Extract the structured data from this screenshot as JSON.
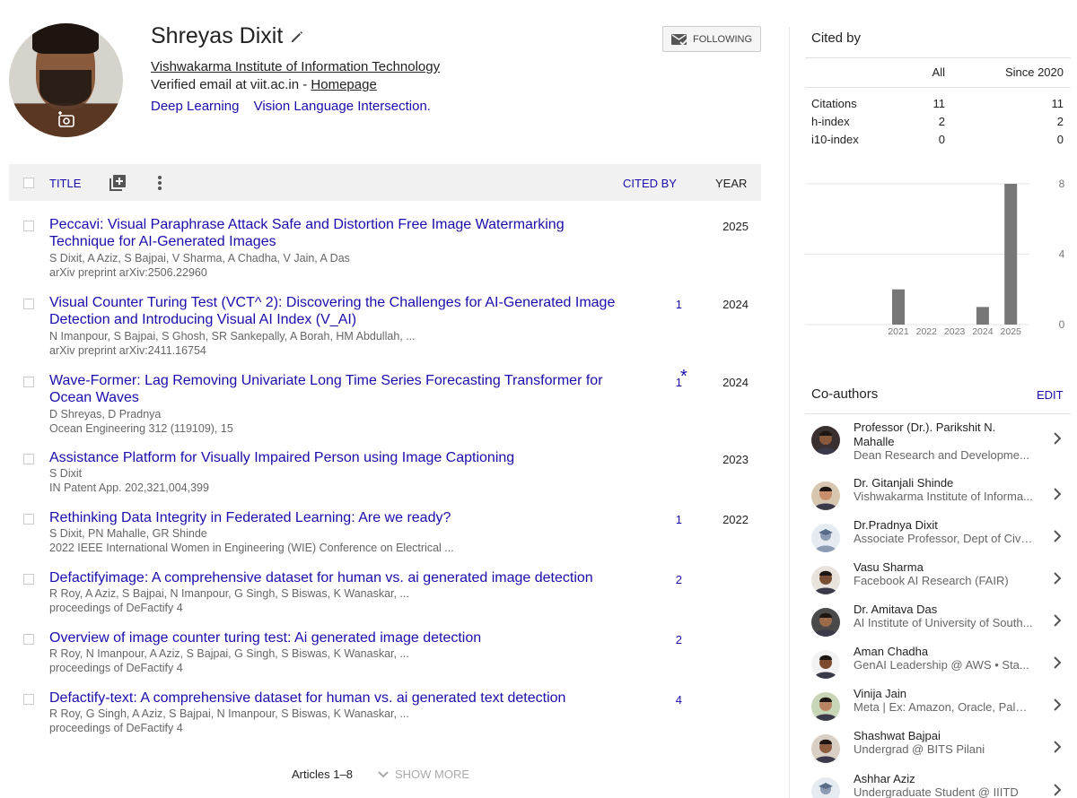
{
  "profile": {
    "name": "Shreyas Dixit",
    "affiliation": "Vishwakarma Institute of Information Technology",
    "email_prefix": "Verified email at viit.ac.in - ",
    "homepage_label": "Homepage",
    "interests": [
      "Deep Learning",
      "Vision Language Intersection."
    ],
    "follow_label": "FOLLOWING"
  },
  "table": {
    "title_header": "TITLE",
    "cited_header": "CITED BY",
    "year_header": "YEAR",
    "articles": [
      {
        "title": "Peccavi: Visual Paraphrase Attack Safe and Distortion Free Image Watermarking Technique for AI-Generated Images",
        "authors": "S Dixit, A Aziz, S Bajpai, V Sharma, A Chadha, V Jain, A Das",
        "venue": "arXiv preprint arXiv:2506.22960",
        "cited": "",
        "year": "2025"
      },
      {
        "title": "Visual Counter Turing Test (VCT^ 2): Discovering the Challenges for AI-Generated Image Detection and Introducing Visual AI Index (V_AI)",
        "authors": "N Imanpour, S Bajpai, S Ghosh, SR Sankepally, A Borah, HM Abdullah, ...",
        "venue": "arXiv preprint arXiv:2411.16754",
        "cited": "1",
        "year": "2024"
      },
      {
        "title": "Wave-Former: Lag Removing Univariate Long Time Series Forecasting Transformer for Ocean Waves",
        "authors": "D Shreyas, D Pradnya",
        "venue": "Ocean Engineering 312 (119109), 15",
        "cited": "1",
        "star": "*",
        "year": "2024"
      },
      {
        "title": "Assistance Platform for Visually Impaired Person using Image Captioning",
        "authors": "S Dixit",
        "venue": "IN Patent App. 202,321,004,399",
        "cited": "",
        "year": "2023"
      },
      {
        "title": "Rethinking Data Integrity in Federated Learning: Are we ready?",
        "authors": "S Dixit, PN Mahalle, GR Shinde",
        "venue": "2022 IEEE International Women in Engineering (WIE) Conference on Electrical ...",
        "cited": "1",
        "year": "2022"
      },
      {
        "title": "Defactifyimage: A comprehensive dataset for human vs. ai generated image detection",
        "authors": "R Roy, A Aziz, S Bajpai, N Imanpour, G Singh, S Biswas, K Wanaskar, ...",
        "venue": "proceedings of DeFactify 4",
        "cited": "2",
        "year": ""
      },
      {
        "title": "Overview of image counter turing test: Ai generated image detection",
        "authors": "R Roy, N Imanpour, A Aziz, S Bajpai, G Singh, S Biswas, K Wanaskar, ...",
        "venue": "proceedings of DeFactify 4",
        "cited": "2",
        "year": ""
      },
      {
        "title": "Defactify-text: A comprehensive dataset for human vs. ai generated text detection",
        "authors": "R Roy, G Singh, A Aziz, S Bajpai, N Imanpour, S Biswas, K Wanaskar, ...",
        "venue": "proceedings of DeFactify 4",
        "cited": "4",
        "year": ""
      }
    ],
    "articles_count": "Articles 1–8",
    "show_more": "SHOW MORE"
  },
  "cited_by": {
    "title": "Cited by",
    "col_all": "All",
    "col_since": "Since 2020",
    "rows": [
      {
        "label": "Citations",
        "all": "11",
        "since": "11"
      },
      {
        "label": "h-index",
        "all": "2",
        "since": "2"
      },
      {
        "label": "i10-index",
        "all": "0",
        "since": "0"
      }
    ]
  },
  "chart_data": {
    "type": "bar",
    "categories": [
      "2021",
      "2022",
      "2023",
      "2024",
      "2025"
    ],
    "values": [
      2,
      0,
      0,
      1,
      8
    ],
    "yticks": [
      0,
      4,
      8
    ],
    "ylim": [
      0,
      8
    ],
    "color": "#777777"
  },
  "coauthors": {
    "title": "Co-authors",
    "edit_label": "EDIT",
    "list": [
      {
        "name": "Professor (Dr.). Parikshit N. Mahalle",
        "affiliation": "Dean Research and Developme...",
        "avatar": "photo"
      },
      {
        "name": "Dr. Gitanjali Shinde",
        "affiliation": "Vishwakarma Institute of Informa...",
        "avatar": "photo"
      },
      {
        "name": "Dr.Pradnya Dixit",
        "affiliation": "Associate Professor, Dept of Civi...",
        "avatar": "placeholder"
      },
      {
        "name": "Vasu Sharma",
        "affiliation": "Facebook AI Research (FAIR)",
        "avatar": "photo"
      },
      {
        "name": "Dr. Amitava Das",
        "affiliation": "AI Institute of University of South...",
        "avatar": "photo"
      },
      {
        "name": "Aman Chadha",
        "affiliation": "GenAI Leadership @ AWS • Sta...",
        "avatar": "photo"
      },
      {
        "name": "Vinija Jain",
        "affiliation": "Meta | Ex: Amazon, Oracle, Palo ...",
        "avatar": "photo"
      },
      {
        "name": "Shashwat Bajpai",
        "affiliation": "Undergrad @ BITS Pilani",
        "avatar": "photo"
      },
      {
        "name": "Ashhar Aziz",
        "affiliation": "Undergraduate Student @ IIITD",
        "avatar": "placeholder"
      }
    ]
  }
}
